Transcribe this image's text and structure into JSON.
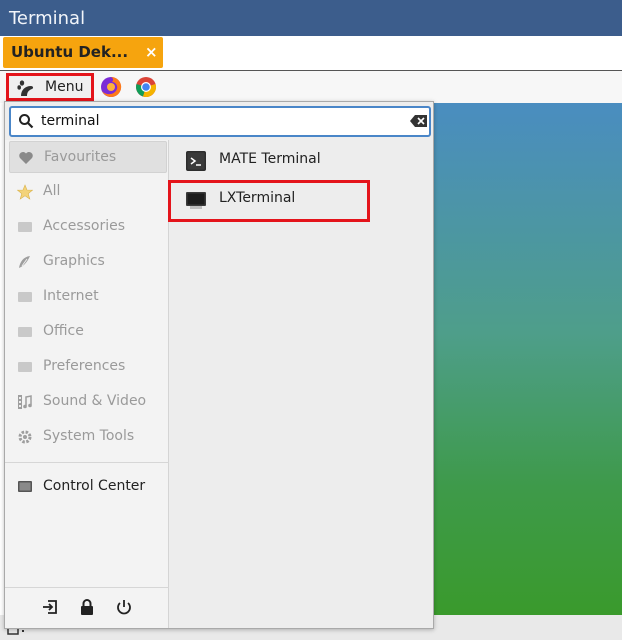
{
  "window": {
    "title": "Terminal"
  },
  "tab": {
    "label": "Ubuntu Dek...",
    "close": "×"
  },
  "panel": {
    "menu_label": "Menu",
    "launchers": [
      "firefox-icon",
      "chrome-icon"
    ]
  },
  "search": {
    "value": "terminal"
  },
  "categories": [
    {
      "label": "Favourites",
      "icon": "heart-icon"
    },
    {
      "label": "All",
      "icon": "star-icon"
    },
    {
      "label": "Accessories",
      "icon": "accessories-icon"
    },
    {
      "label": "Graphics",
      "icon": "graphics-icon"
    },
    {
      "label": "Internet",
      "icon": "internet-icon"
    },
    {
      "label": "Office",
      "icon": "office-icon"
    },
    {
      "label": "Preferences",
      "icon": "preferences-icon"
    },
    {
      "label": "Sound & Video",
      "icon": "sound-video-icon"
    },
    {
      "label": "System Tools",
      "icon": "system-tools-icon"
    },
    {
      "label": "Control Center",
      "icon": "control-center-icon"
    }
  ],
  "results": [
    {
      "label": "MATE Terminal",
      "icon": "mate-terminal-icon"
    },
    {
      "label": "LXTerminal",
      "icon": "lxterminal-icon"
    }
  ],
  "session_buttons": [
    "logout-icon",
    "lock-icon",
    "power-icon"
  ],
  "colors": {
    "highlight": "#e4141b",
    "tab": "#f6a40e",
    "titlebar": "#3c5d8c"
  }
}
